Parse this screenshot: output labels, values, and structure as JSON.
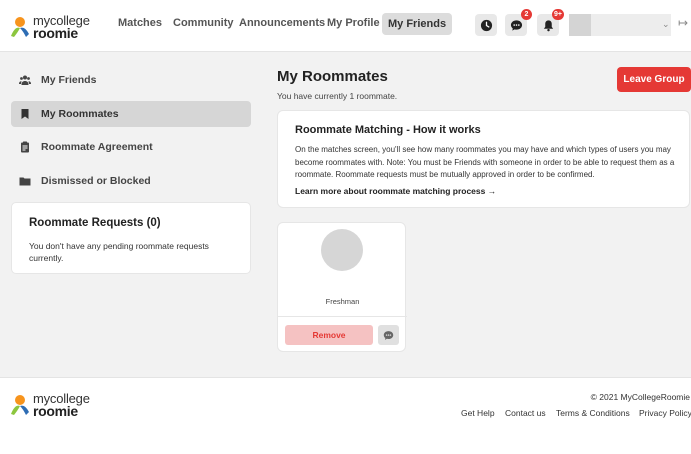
{
  "brand": {
    "name_top": "mycollege",
    "name_bottom": "roomie"
  },
  "nav": {
    "matches": "Matches",
    "community": "Community",
    "announcements": "Announcements",
    "my_profile": "My Profile",
    "my_friends": "My Friends"
  },
  "header_icons": {
    "messages_badge": "2",
    "notifications_badge": "9+"
  },
  "sidebar": {
    "items": [
      {
        "label": "My Friends",
        "icon": "people-icon"
      },
      {
        "label": "My Roommates",
        "icon": "bookmark-icon"
      },
      {
        "label": "Roommate Agreement",
        "icon": "clipboard-icon"
      },
      {
        "label": "Dismissed or Blocked",
        "icon": "folder-icon"
      }
    ],
    "requests": {
      "title": "Roommate Requests (0)",
      "text": "You don't have any pending roommate requests currently."
    }
  },
  "main": {
    "title": "My Roommates",
    "subtitle": "You have currently 1 roommate.",
    "leave_button": "Leave Group",
    "how": {
      "title": "Roommate Matching - How it works",
      "text": "On the matches screen, you'll see how many roommates you may have and which types of users you may become roommates with. Note: You must be Friends with someone in order to be able to request them as a roommate. Roommate requests must be mutually approved in order to be confirmed.",
      "link": "Learn more about roommate matching process →"
    },
    "roommate": {
      "year": "Freshman",
      "remove_button": "Remove"
    }
  },
  "footer": {
    "copyright": "© 2021 MyCollegeRoomie",
    "links": [
      "Get Help",
      "Contact us",
      "Terms & Conditions",
      "Privacy Policy"
    ]
  },
  "colors": {
    "accent_red": "#e53935",
    "logo_orange": "#f7941d",
    "logo_green": "#8cc63f",
    "logo_blue": "#2e6db4"
  }
}
